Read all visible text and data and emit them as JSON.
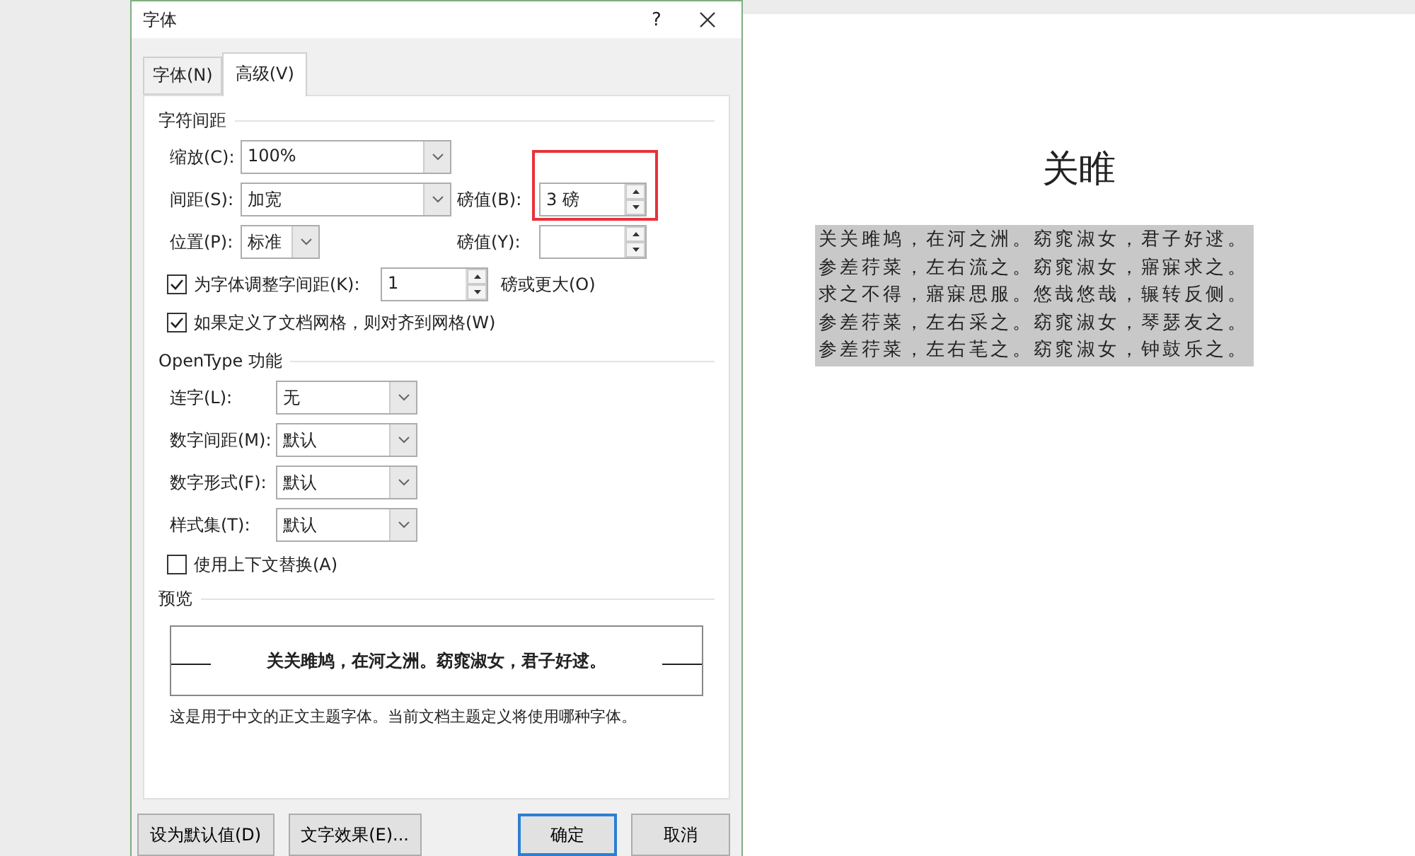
{
  "window": {
    "title": "字体",
    "help": "?"
  },
  "tabs": [
    {
      "label": "字体(N)",
      "selected": false
    },
    {
      "label": "高级(V)",
      "selected": true
    }
  ],
  "character_spacing": {
    "title": "字符间距",
    "scale": {
      "label": "缩放(C):",
      "value": "100%"
    },
    "spacing": {
      "label": "间距(S):",
      "value": "加宽"
    },
    "spacing_amount": {
      "label": "磅值(B):",
      "value": "3 磅",
      "highlighted": true
    },
    "position": {
      "label": "位置(P):",
      "value": "标准"
    },
    "position_amount": {
      "label": "磅值(Y):"
    },
    "kerning": {
      "label": "为字体调整字间距(K):",
      "checked": true,
      "value": "1",
      "suffix": "磅或更大(O)"
    },
    "snap_to_grid": {
      "label": "如果定义了文档网格，则对齐到网格(W)",
      "checked": true
    }
  },
  "opentype": {
    "title": "OpenType 功能",
    "selects": [
      {
        "label": "连字(L):",
        "value": "无"
      },
      {
        "label": "数字间距(M):",
        "value": "默认"
      },
      {
        "label": "数字形式(F):",
        "value": "默认"
      },
      {
        "label": "样式集(T):",
        "value": "默认"
      }
    ],
    "contextual": {
      "label": "使用上下文替换(A)",
      "checked": false
    }
  },
  "preview": {
    "title": "预览",
    "sample": "关关雎鸠，在河之洲。窈窕淑女，君子好逑。",
    "note": "这是用于中文的正文主题字体。当前文档主题定义将使用哪种字体。"
  },
  "buttons": [
    {
      "label": "设为默认值(D)",
      "default": false
    },
    {
      "label": "文字效果(E)...",
      "default": false
    },
    {
      "label": "确定",
      "default": true
    },
    {
      "label": "取消",
      "default": false
    }
  ],
  "document": {
    "title": "关睢",
    "selected": true,
    "lines": [
      "关关雎鸠，在河之洲。窈窕淑女，君子好逑。",
      "参差荇菜，左右流之。窈窕淑女，寤寐求之。",
      "求之不得，寤寐思服。悠哉悠哉，辗转反侧。",
      "参差荇菜，左右采之。窈窕淑女，琴瑟友之。",
      "参差荇菜，左右芼之。窈窕淑女，钟鼓乐之。"
    ]
  }
}
